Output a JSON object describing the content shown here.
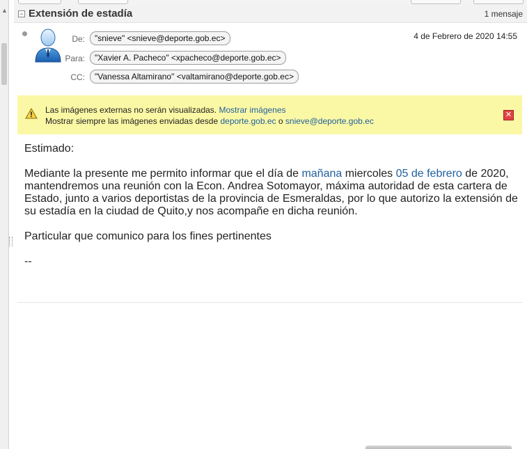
{
  "thread": {
    "subject": "Extensión de estadía",
    "count": "1 mensaje",
    "collapse_symbol": "−"
  },
  "message": {
    "from_label": "De:",
    "from": "\"snieve\" <snieve@deporte.gob.ec>",
    "to_label": "Para:",
    "to": "\"Xavier A. Pacheco\" <xpacheco@deporte.gob.ec>",
    "cc_label": "CC:",
    "cc": "\"Vanessa Altamirano\" <valtamirano@deporte.gob.ec>",
    "date": "4 de Febrero de 2020 14:55"
  },
  "notice": {
    "text1": "Las imágenes externas no serán visualizadas.",
    "show_images": "Mostrar imágenes",
    "text2": "Mostrar siempre las imágenes enviadas desde",
    "domain_link": "deporte.gob.ec",
    "or": "o",
    "sender_link": "snieve@deporte.gob.ec",
    "close_symbol": "✕"
  },
  "body": {
    "greeting": "Estimado:",
    "p1_a": "Mediante la presente me permito informar que el día de ",
    "p1_link1": "mañana",
    "p1_b": " miercoles ",
    "p1_link2": "05 de febrero",
    "p1_c": " de 2020, mantendremos una reunión con la Econ. Andrea Sotomayor, máxima autoridad de esta cartera de Estado, junto a varios deportistas de la provincia de Esmeraldas, por lo que autorizo la extensión de su estadía en la ciudad de Quito,y nos acompañe en dicha reunión.",
    "p2": "Particular que comunico para los fines pertinentes",
    "signature": "--"
  },
  "colors": {
    "notice_bg": "#fbf8a5",
    "link": "#1f5f9e",
    "close": "#e04444"
  }
}
